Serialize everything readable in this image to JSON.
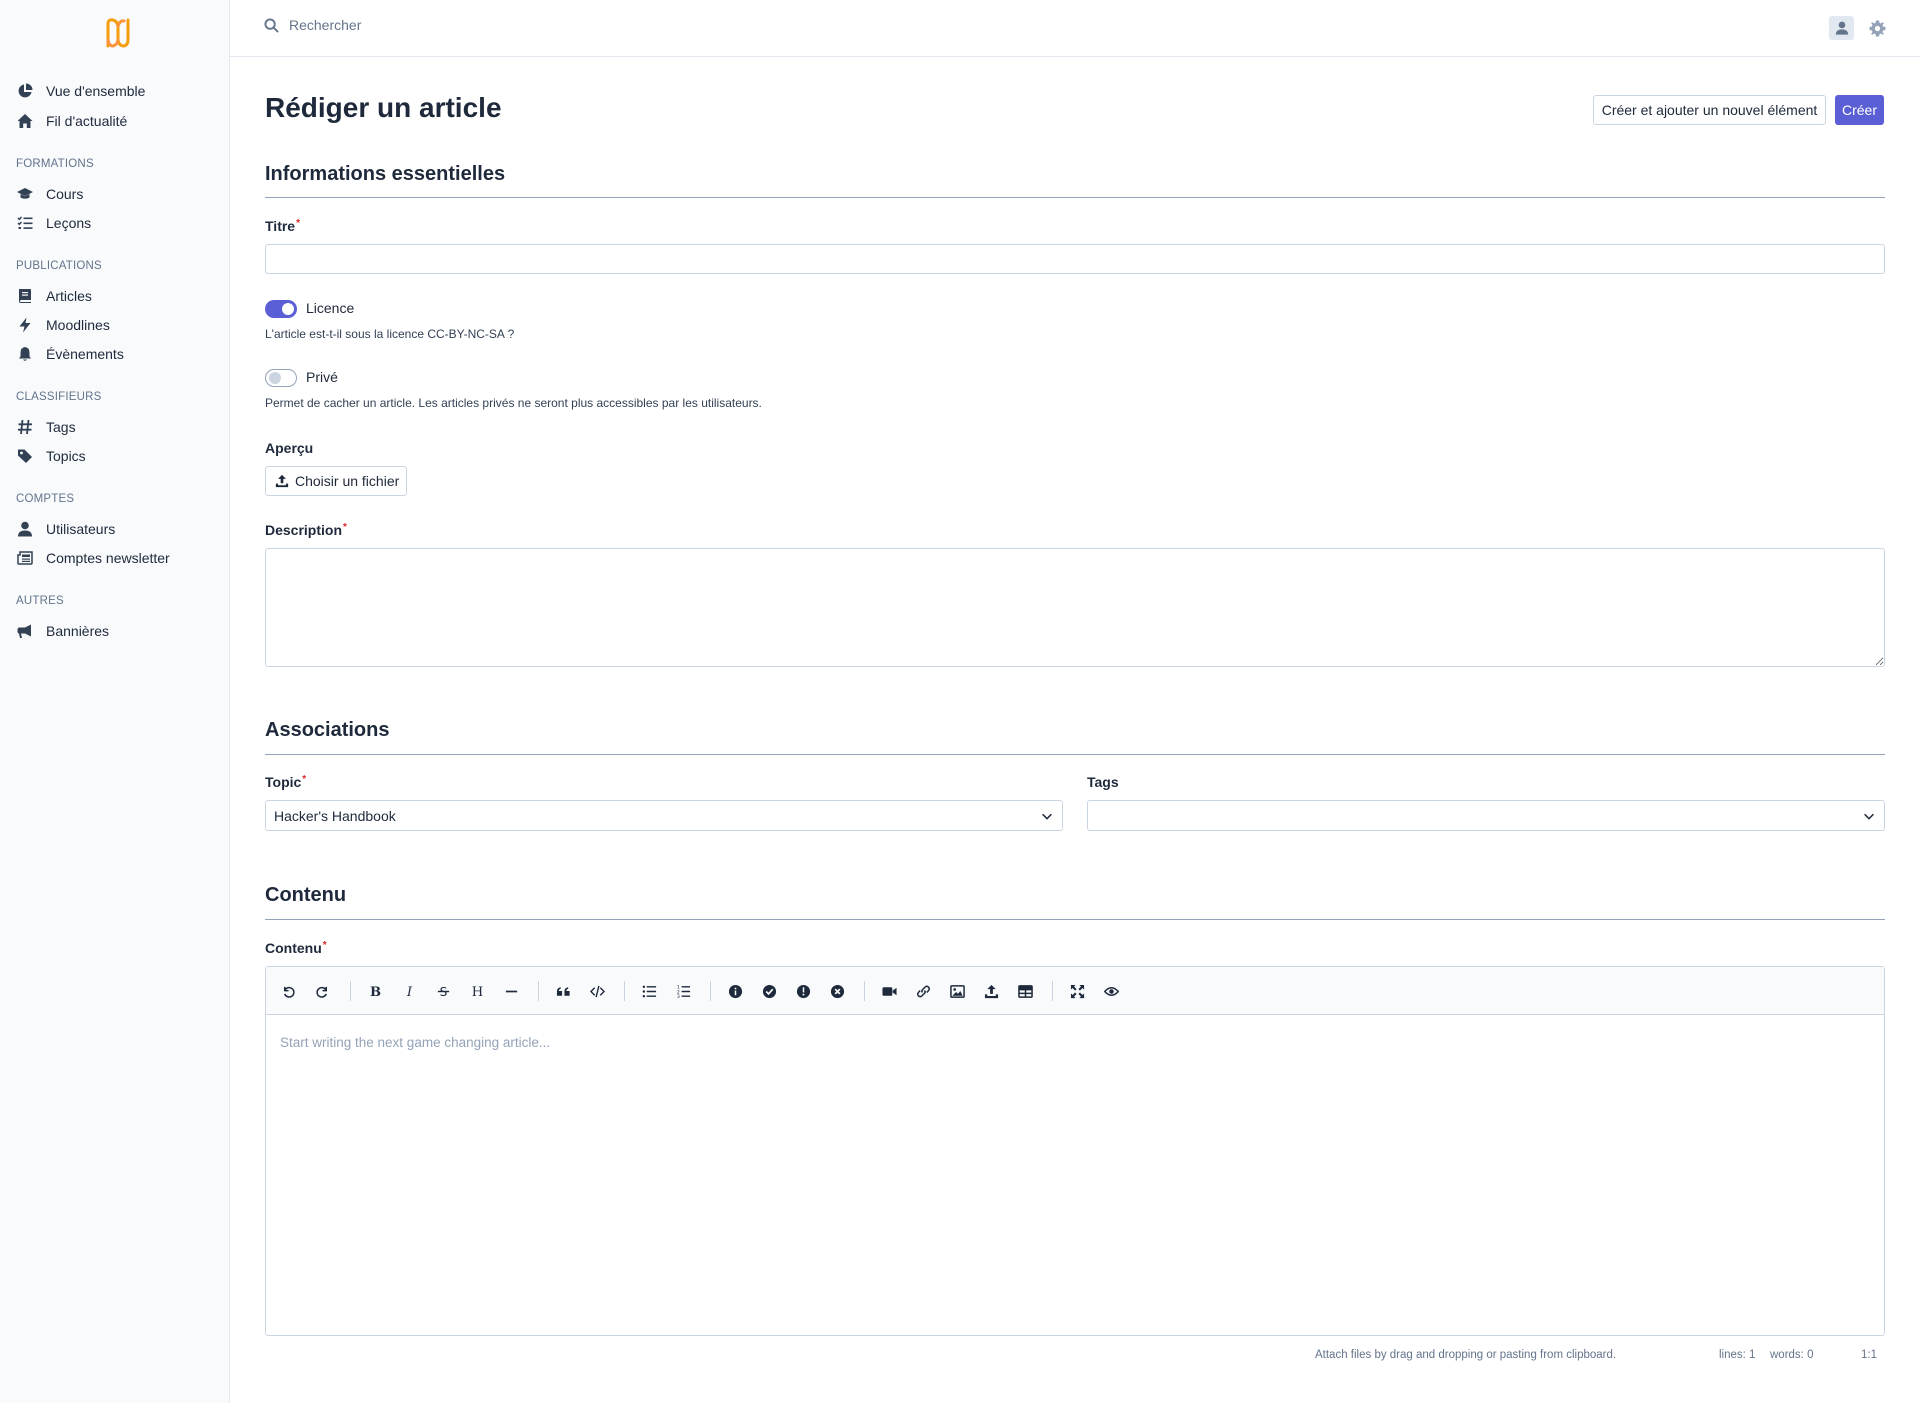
{
  "topbar": {
    "search_placeholder": "Rechercher"
  },
  "sidebar": {
    "top_items": [
      {
        "label": "Vue d'ensemble",
        "icon": "chart-pie-icon"
      },
      {
        "label": "Fil d'actualité",
        "icon": "home-icon"
      }
    ],
    "sections": [
      {
        "title": "FORMATIONS",
        "items": [
          {
            "label": "Cours",
            "icon": "graduation-cap-icon"
          },
          {
            "label": "Leçons",
            "icon": "list-check-icon"
          }
        ]
      },
      {
        "title": "PUBLICATIONS",
        "items": [
          {
            "label": "Articles",
            "icon": "book-icon"
          },
          {
            "label": "Moodlines",
            "icon": "bolt-icon"
          },
          {
            "label": "Évènements",
            "icon": "bell-icon"
          }
        ]
      },
      {
        "title": "CLASSIFIEURS",
        "items": [
          {
            "label": "Tags",
            "icon": "hashtag-icon"
          },
          {
            "label": "Topics",
            "icon": "tag-icon"
          }
        ]
      },
      {
        "title": "COMPTES",
        "items": [
          {
            "label": "Utilisateurs",
            "icon": "user-icon"
          },
          {
            "label": "Comptes newsletter",
            "icon": "newspaper-icon"
          }
        ]
      },
      {
        "title": "AUTRES",
        "items": [
          {
            "label": "Bannières",
            "icon": "megaphone-icon"
          }
        ]
      }
    ]
  },
  "page": {
    "title": "Rédiger un article",
    "create_and_add_label": "Créer et ajouter un nouvel élément",
    "create_label": "Créer"
  },
  "essentials": {
    "heading": "Informations essentielles",
    "title_label": "Titre",
    "title_value": "",
    "license_label": "Licence",
    "license_on": true,
    "license_help": "L'article est-t-il sous la licence CC-BY-NC-SA ?",
    "private_label": "Privé",
    "private_on": false,
    "private_help": "Permet de cacher un article. Les articles privés ne seront plus accessibles par les utilisateurs.",
    "preview_label": "Aperçu",
    "file_button_label": "Choisir un fichier",
    "description_label": "Description",
    "required_mark": "*"
  },
  "associations": {
    "heading": "Associations",
    "topic_label": "Topic",
    "topic_value": "Hacker's Handbook",
    "tags_label": "Tags",
    "tags_value": ""
  },
  "content": {
    "heading": "Contenu",
    "editor_label": "Contenu",
    "editor_placeholder": "Start writing the next game changing article...",
    "toolbar_icons": [
      "undo-icon",
      "redo-icon",
      "bold-icon",
      "italic-icon",
      "strikethrough-icon",
      "heading-icon",
      "horizontal-rule-icon",
      "quote-icon",
      "code-icon",
      "bullet-list-icon",
      "numbered-list-icon",
      "info-icon",
      "check-circle-icon",
      "exclamation-icon",
      "times-circle-icon",
      "video-icon",
      "link-icon",
      "image-icon",
      "upload-icon",
      "table-icon",
      "fullscreen-icon",
      "preview-eye-icon"
    ],
    "status_attach": "Attach files by drag and dropping or pasting from clipboard.",
    "status_lines": "lines: 1",
    "status_words": "words: 0",
    "status_cursor": "1:1"
  },
  "colors": {
    "accent": "#5a5fd6",
    "logo": "#f59e0b",
    "required": "#dc2626"
  }
}
